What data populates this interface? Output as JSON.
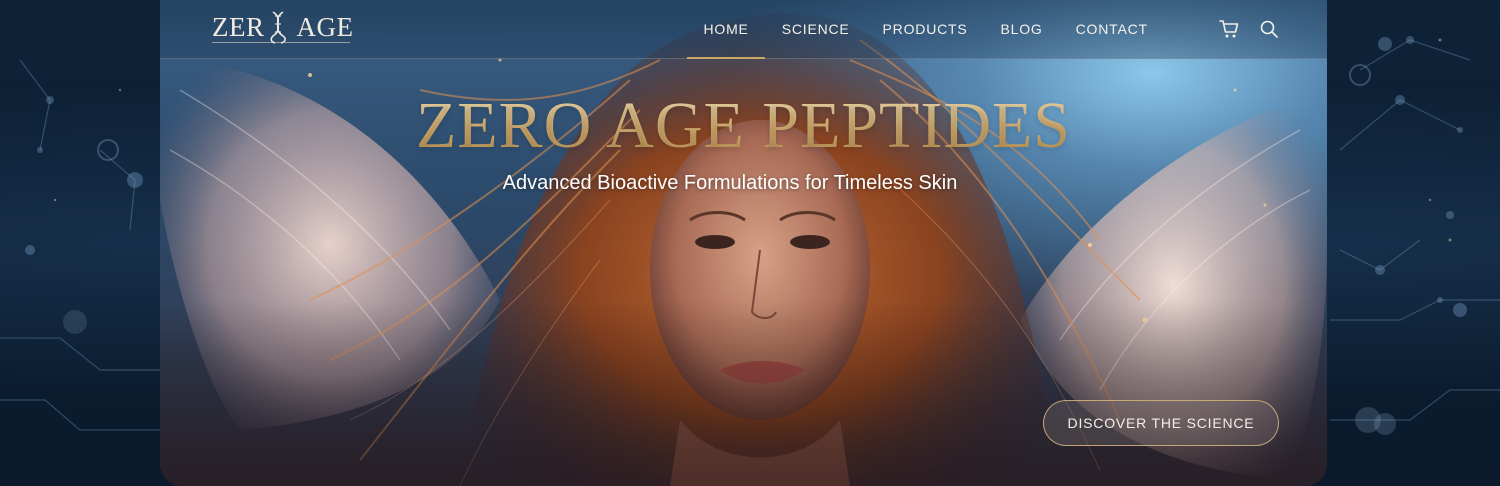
{
  "brand": {
    "logo_left": "ZER",
    "logo_right": "AGE"
  },
  "nav": {
    "items": [
      {
        "label": "HOME",
        "active": true
      },
      {
        "label": "SCIENCE",
        "active": false
      },
      {
        "label": "PRODUCTS",
        "active": false
      },
      {
        "label": "BLOG",
        "active": false
      },
      {
        "label": "CONTACT",
        "active": false
      }
    ],
    "icons": [
      "cart-icon",
      "search-icon"
    ]
  },
  "hero": {
    "title": "ZERO AGE PEPTIDES",
    "subtitle": "Advanced Bioactive Formulations for Timeless Skin",
    "cta_label": "DISCOVER THE SCIENCE"
  },
  "colors": {
    "background": "#0b1c30",
    "gold_accent": "#c9a86a",
    "nav_text": "#f3f0ea"
  }
}
